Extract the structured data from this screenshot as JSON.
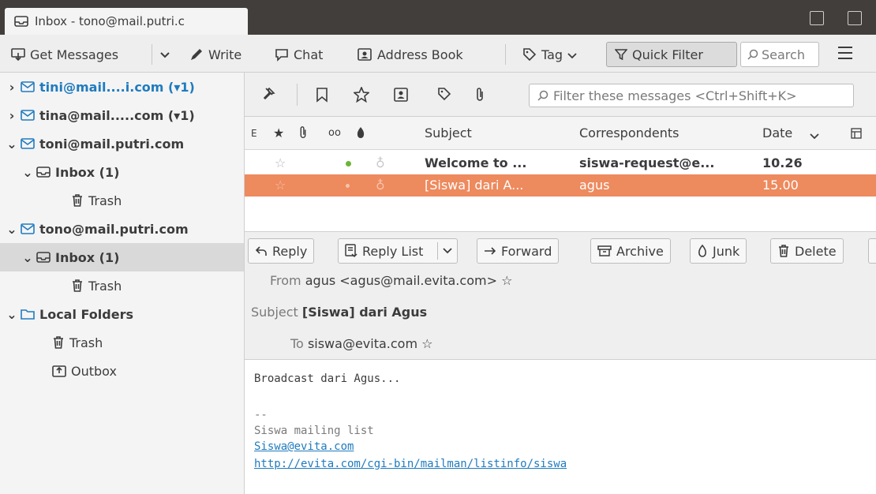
{
  "window": {
    "tab_title": "Inbox - tono@mail.putri.c",
    "right_icons": [
      "calendar-icon",
      "tasks-icon"
    ]
  },
  "toolbar": {
    "get_messages": "Get Messages",
    "write": "Write",
    "chat": "Chat",
    "address_book": "Address Book",
    "tag": "Tag",
    "quick_filter": "Quick Filter",
    "search_placeholder": "Search"
  },
  "folders": [
    {
      "label": "tini@mail....i.com (▾1)",
      "type": "account",
      "expanded": false,
      "color": "#1f7bbf"
    },
    {
      "label": "tina@mail.....com (▾1)",
      "type": "account",
      "expanded": false
    },
    {
      "label": "toni@mail.putri.com",
      "type": "account",
      "expanded": true
    },
    {
      "label": "Inbox (1)",
      "type": "inbox",
      "expanded": true
    },
    {
      "label": "Trash",
      "type": "trash"
    },
    {
      "label": "tono@mail.putri.com",
      "type": "account",
      "expanded": true
    },
    {
      "label": "Inbox (1)",
      "type": "inbox",
      "expanded": true,
      "selected": true
    },
    {
      "label": "Trash",
      "type": "trash"
    },
    {
      "label": "Local Folders",
      "type": "local",
      "expanded": true
    },
    {
      "label": "Trash",
      "type": "trash"
    },
    {
      "label": "Outbox",
      "type": "outbox"
    }
  ],
  "filter_placeholder": "Filter these messages <Ctrl+Shift+K>",
  "columns": {
    "subject": "Subject",
    "correspondents": "Correspondents",
    "date": "Date"
  },
  "messages": [
    {
      "subject": "Welcome to ...",
      "correspondent": "siswa-request@e...",
      "date": "10.26",
      "unread": true,
      "selected": false
    },
    {
      "subject": "[Siswa] dari A...",
      "correspondent": "agus",
      "date": "15.00",
      "unread": false,
      "selected": true
    }
  ],
  "reader": {
    "buttons": {
      "reply": "Reply",
      "reply_list": "Reply List",
      "forward": "Forward",
      "archive": "Archive",
      "junk": "Junk",
      "delete": "Delete"
    },
    "from_label": "From",
    "from_value": "agus <agus@mail.evita.com>",
    "subject_label": "Subject",
    "subject_value": "[Siswa] dari Agus",
    "to_label": "To",
    "to_value": "siswa@evita.com"
  },
  "body": {
    "line1": "Broadcast dari Agus...",
    "sig_sep": "--",
    "sig_name": "Siswa mailing list",
    "sig_email": "Siswa@evita.com",
    "sig_url": "http://evita.com/cgi-bin/mailman/listinfo/siswa"
  },
  "colors": {
    "selected_row": "#ed8a5e",
    "link": "#1f7bbf",
    "unread_dot": "#6bb535"
  }
}
